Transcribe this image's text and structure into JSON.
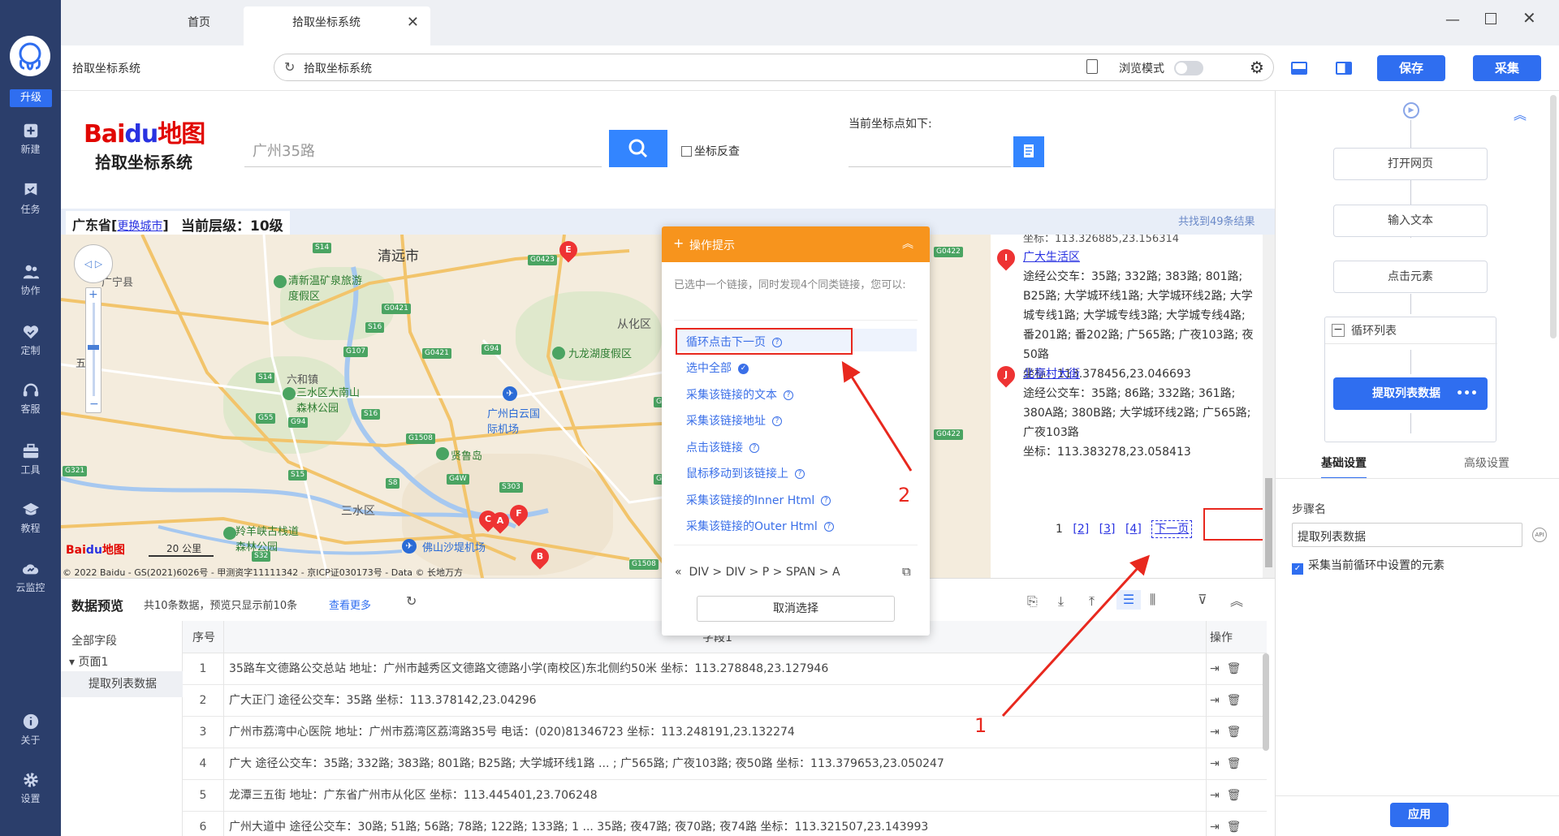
{
  "nav": {
    "upgrade": "升级",
    "items": [
      {
        "label": "新建",
        "icon": "plus-icon"
      },
      {
        "label": "任务",
        "icon": "check-flag-icon"
      },
      {
        "label": "协作",
        "icon": "users-icon"
      },
      {
        "label": "定制",
        "icon": "heart-check-icon"
      },
      {
        "label": "客服",
        "icon": "headset-icon"
      },
      {
        "label": "工具",
        "icon": "toolbox-icon"
      },
      {
        "label": "教程",
        "icon": "graduation-cap-icon"
      },
      {
        "label": "云监控",
        "icon": "cloud-chart-icon"
      }
    ],
    "about": "关于",
    "settings": "设置"
  },
  "tabs": [
    {
      "label": "首页"
    },
    {
      "label": "拾取坐标系统",
      "active": true
    }
  ],
  "toolbar": {
    "page_title": "拾取坐标系统",
    "url": "拾取坐标系统",
    "browse_mode": "浏览模式",
    "save": "保存",
    "collect": "采集"
  },
  "baidu": {
    "logo_text": "Bai地图",
    "subtitle": "拾取坐标系统",
    "search_placeholder": "广州35路",
    "reverse_label": "坐标反查",
    "coord_label": "当前坐标点如下:",
    "province": "广东省",
    "change_city": "更换城市",
    "level": "当前层级：10级",
    "found": "共找到49条结果",
    "copyright": "© 2022 Baidu - GS(2021)6026号 - 甲测资字11111342 - 京ICP证030173号 - Data © 长地万方",
    "scale": "20 公里"
  },
  "map_places": [
    "清远市",
    "清新温矿泉旅游度假区",
    "从化区",
    "九龙湖度假区",
    "六和镇",
    "三水区大南山森林公园",
    "广州白云国际机场",
    "贤鲁岛",
    "三水区",
    "羚羊峡古栈道森林公园",
    "佛山沙堤机场",
    "五和",
    "广宁县"
  ],
  "results": [
    {
      "marker": "I",
      "name": "广大生活区",
      "bus": "途经公交车：35路; 332路; 383路; 801路; B25路; 大学城环线1路; 大学城环线2路; 大学城专线1路; 大学城专线3路; 大学城专线4路; 番201路; 番202路; 广565路; 广夜103路; 夜50路",
      "coord": "坐标：113.378456,23.046693"
    },
    {
      "marker": "J",
      "name": "北亭村大街",
      "bus": "途经公交车：35路; 86路; 332路; 361路; 380A路; 380B路; 大学城环线2路; 广565路; 广夜103路",
      "coord": "坐标：113.383278,23.058413"
    }
  ],
  "top_partial_coord": "坐标：113.326885,23.156314",
  "pagination": {
    "current": "1",
    "pages": [
      "[2]",
      "[3]",
      "[4]"
    ],
    "next": "下一页"
  },
  "popup": {
    "title": "操作提示",
    "description": "已选中一个链接，同时发现4个同类链接，您可以:",
    "options": [
      "循环点击下一页",
      "选中全部",
      "采集该链接的文本",
      "采集该链接地址",
      "点击该链接",
      "鼠标移动到该链接上",
      "采集该链接的Inner Html",
      "采集该链接的Outer Html"
    ],
    "path": [
      "DIV",
      "DIV",
      "P",
      "SPAN",
      "A"
    ],
    "cancel": "取消选择"
  },
  "annotations": {
    "arrow1": "1",
    "arrow2": "2"
  },
  "preview": {
    "title": "数据预览",
    "summary": "共10条数据，预览只显示前10条",
    "more": "查看更多",
    "tree_all": "全部字段",
    "tree_page": "页面1",
    "tree_field": "提取列表数据",
    "col_index": "序号",
    "col_field": "字段1",
    "col_ops": "操作",
    "rows": [
      {
        "i": "1",
        "text": "35路车文德路公交总站 地址：广州市越秀区文德路文德路小学(南校区)东北侧约50米 坐标：113.278848,23.127946"
      },
      {
        "i": "2",
        "text": "广大正门 途径公交车：35路 坐标：113.378142,23.04296"
      },
      {
        "i": "3",
        "text": "广州市荔湾中心医院 地址：广州市荔湾区荔湾路35号 电话：(020)81346723 坐标：113.248191,23.132274"
      },
      {
        "i": "4",
        "text": "广大 途径公交车：35路; 332路; 383路; 801路; B25路; 大学城环线1路 ... ; 广565路; 广夜103路; 夜50路 坐标：113.379653,23.050247"
      },
      {
        "i": "5",
        "text": "龙潭三五街 地址：广东省广州市从化区 坐标：113.445401,23.706248"
      },
      {
        "i": "6",
        "text": "广州大道中 途径公交车：30路; 51路; 56路; 78路; 122路; 133路; 1 ... 35路; 夜47路; 夜70路; 夜74路 坐标：113.321507,23.143993"
      }
    ]
  },
  "flow": {
    "steps": [
      "打开网页",
      "输入文本",
      "点击元素"
    ],
    "loop": "循环列表",
    "loop_step": "提取列表数据",
    "tab_basic": "基础设置",
    "tab_advanced": "高级设置",
    "step_name_label": "步骤名",
    "step_name_value": "提取列表数据",
    "checkbox_label": "采集当前循环中设置的元素",
    "apply": "应用"
  },
  "colors": {
    "accent": "#2f6ef0",
    "nav_bg": "#2b3e6b",
    "popup_header": "#f7941d",
    "annotation": "#e8281e"
  }
}
